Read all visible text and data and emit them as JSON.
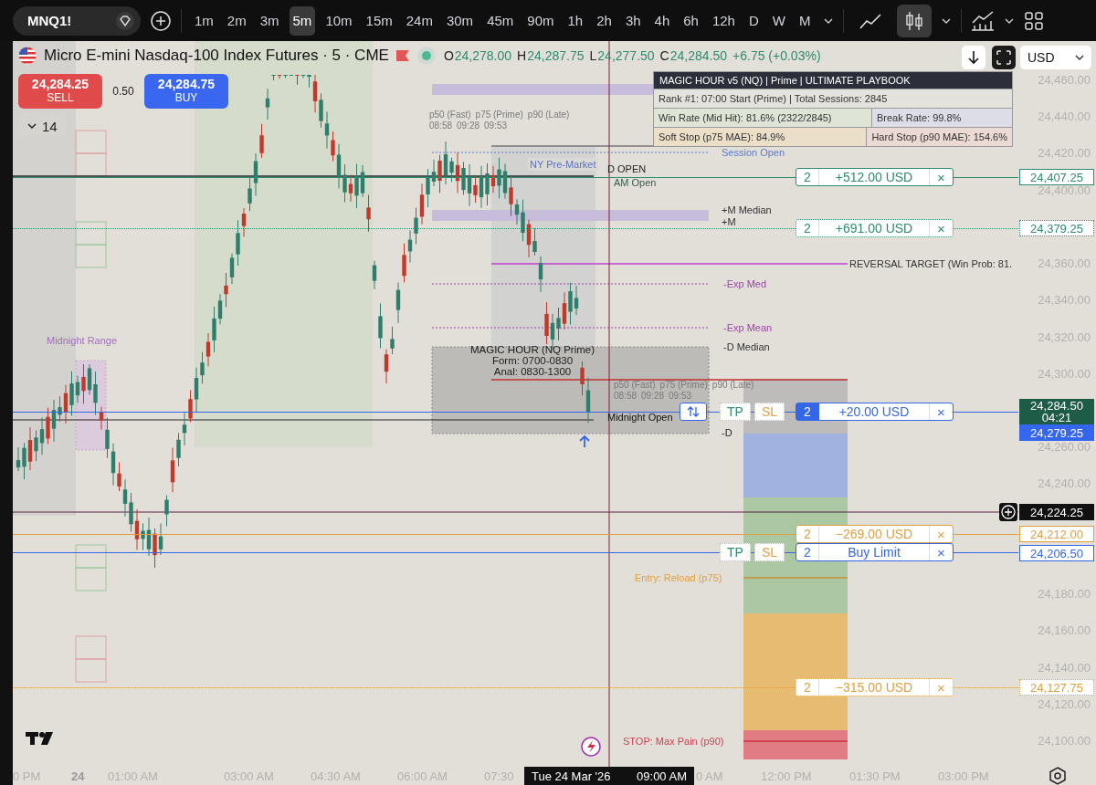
{
  "toolbar": {
    "symbol": "MNQ1!",
    "intervals": [
      {
        "label": "1m",
        "selected": false
      },
      {
        "label": "2m",
        "selected": false
      },
      {
        "label": "3m",
        "selected": false
      },
      {
        "label": "5m",
        "selected": true
      },
      {
        "label": "10m",
        "selected": false
      },
      {
        "label": "15m",
        "selected": false
      },
      {
        "label": "24m",
        "selected": false
      },
      {
        "label": "30m",
        "selected": false
      },
      {
        "label": "45m",
        "selected": false
      },
      {
        "label": "90m",
        "selected": false
      },
      {
        "label": "1h",
        "selected": false
      },
      {
        "label": "2h",
        "selected": false
      },
      {
        "label": "3h",
        "selected": false
      },
      {
        "label": "4h",
        "selected": false
      },
      {
        "label": "6h",
        "selected": false
      },
      {
        "label": "12h",
        "selected": false
      },
      {
        "label": "D",
        "selected": false
      },
      {
        "label": "W",
        "selected": false
      },
      {
        "label": "M",
        "selected": false
      }
    ],
    "chart_types": [
      {
        "kind": "line",
        "selected": false
      },
      {
        "kind": "candles",
        "selected": true
      }
    ]
  },
  "legend": {
    "title": "Micro E-mini Nasdaq-100 Index Futures · 5 · CME",
    "ohlc": [
      {
        "label": "O",
        "value": "24,278.00"
      },
      {
        "label": "H",
        "value": "24,287.75"
      },
      {
        "label": "L",
        "value": "24,277.50"
      },
      {
        "label": "C",
        "value": "24,284.50"
      }
    ],
    "change": "+6.75 (+0.03%)",
    "sell": {
      "price": "24,284.25",
      "label": "SELL"
    },
    "spread": "0.50",
    "buy": {
      "price": "24,284.75",
      "label": "BUY"
    },
    "indicators_count": "14"
  },
  "currency": "USD",
  "stats_panel": {
    "title": "MAGIC HOUR v5 (NQ) | Prime | ULTIMATE PLAYBOOK",
    "rows": [
      {
        "cells": [
          {
            "text": "Rank #1: 07:00 Start (Prime) | Total Sessions: 2845",
            "color": "#e4e2dd"
          }
        ]
      },
      {
        "cells": [
          {
            "text": "Win Rate (Mid Hit): 81.6% (2322/2845)",
            "color": "#dfe5d6"
          },
          {
            "text": "Break Rate: 99.8%",
            "color": "#dcdde6"
          }
        ]
      },
      {
        "cells": [
          {
            "text": "Soft Stop (p75 MAE): 84.9%",
            "color": "#ebdfc8"
          },
          {
            "text": "Hard Stop (p90 MAE): 154.6%",
            "color": "#ebd9d3"
          }
        ]
      }
    ]
  },
  "levels": [
    {
      "label": "Session Open",
      "color": "#5b7bd0"
    },
    {
      "label": "NY Pre-Market",
      "color": "#5b73bd"
    },
    {
      "label": "D OPEN",
      "color": "#222222"
    },
    {
      "label": "AM Open",
      "color": "#3b5e4c"
    },
    {
      "label": "+M Median",
      "color": "#333333"
    },
    {
      "label": "+M",
      "color": "#333333"
    },
    {
      "label": "REVERSAL TARGET (Win Prob: 81.",
      "color": "#333333"
    },
    {
      "label": "-Exp Med",
      "color": "#a040b0"
    },
    {
      "label": "-Exp Mean",
      "color": "#a040b0"
    },
    {
      "label": "-D Median",
      "color": "#333333"
    },
    {
      "label": "Midnight Open",
      "color": "#111111"
    },
    {
      "label": "-D",
      "color": "#222222"
    },
    {
      "label": "Midnight Range",
      "color": "#a070b8"
    },
    {
      "label": "Entry: Reload (p75)",
      "color": "#e0a040"
    },
    {
      "label": "STOP: Max Pain (p90)",
      "color": "#d04050"
    }
  ],
  "session_note": [
    "MAGIC HOUR (NQ Prime)",
    "Form: 0700-0830",
    "Anal: 0830-1300"
  ],
  "percentile_markers": [
    {
      "labels": [
        "p50 (Fast)",
        "p75 (Prime)",
        "p90 (Late)"
      ],
      "times": [
        "08:58",
        "09:28",
        "09:53"
      ]
    },
    {
      "labels": [
        "p50 (Fast)",
        "p75 (Prime)",
        "p90 (Late)"
      ],
      "times": [
        "08:58",
        "09:28",
        "09:53"
      ]
    }
  ],
  "order_lines": [
    {
      "qty": "2",
      "text": "+512.00 USD",
      "close": "×",
      "color": "#2e8b6e",
      "dotted": false,
      "filled_qty": false
    },
    {
      "qty": "2",
      "text": "+691.00 USD",
      "close": "×",
      "color": "#2e8b6e",
      "dotted": true,
      "filled_qty": false
    },
    {
      "qty": "2",
      "text": "+20.00 USD",
      "close": "×",
      "color": "#3466e8",
      "dotted": false,
      "reverse": true,
      "filled_qty": true,
      "brackets": [
        {
          "label": "TP",
          "color": "#2e8b6e"
        },
        {
          "label": "SL",
          "color": "#e0a040"
        }
      ]
    },
    {
      "qty": "2",
      "text": "−269.00 USD",
      "close": "×",
      "color": "#e0a040",
      "dotted": false,
      "filled_qty": false
    },
    {
      "qty": "2",
      "text": "Buy Limit",
      "close": "×",
      "color": "#3466e8",
      "dotted": false,
      "filled_qty": false,
      "brackets": [
        {
          "label": "TP",
          "color": "#2e8b6e"
        },
        {
          "label": "SL",
          "color": "#e0a040"
        }
      ]
    },
    {
      "qty": "2",
      "text": "−315.00 USD",
      "close": "×",
      "color": "#e0a040",
      "dotted": true,
      "filled_qty": false
    }
  ],
  "price_axis": {
    "labels": [
      "24,460.00",
      "24,440.00",
      "24,420.00",
      "24,400.00",
      "24,360.00",
      "24,340.00",
      "24,320.00",
      "24,300.00",
      "24,260.00",
      "24,240.00",
      "24,180.00",
      "24,160.00",
      "24,140.00",
      "24,120.00",
      "24,100.00"
    ],
    "badges": [
      {
        "text": "24,407.25",
        "kind": "order",
        "color": "#2e8b6e"
      },
      {
        "text": "24,379.25",
        "kind": "pending",
        "color": "#2e8b6e"
      },
      {
        "text": "24,284.50",
        "sub": "04:21",
        "kind": "last",
        "color": "#1f5c48"
      },
      {
        "text": "24,279.25",
        "kind": "average",
        "color": "#3466f0"
      },
      {
        "text": "24,224.25",
        "kind": "crosshair",
        "color": "#111111"
      },
      {
        "text": "24,212.00",
        "kind": "order",
        "color": "#e0a040"
      },
      {
        "text": "24,206.50",
        "kind": "order",
        "color": "#3466e8"
      },
      {
        "text": "24,127.75",
        "kind": "pending",
        "color": "#e0a040"
      }
    ]
  },
  "time_axis": {
    "labels": [
      {
        "text": "0 PM",
        "bold": false
      },
      {
        "text": "24",
        "bold": true
      },
      {
        "text": "01:00 AM",
        "bold": false
      },
      {
        "text": "03:00 AM",
        "bold": false
      },
      {
        "text": "04:30 AM",
        "bold": false
      },
      {
        "text": "06:00 AM",
        "bold": false
      },
      {
        "text": "07:30",
        "bold": false
      },
      {
        "text": "0 AM",
        "bold": false
      },
      {
        "text": "12:00 PM",
        "bold": false
      },
      {
        "text": "01:30 PM",
        "bold": false
      },
      {
        "text": "03:00 PM",
        "bold": false
      }
    ],
    "crosshair": {
      "date": "Tue 24 Mar '26",
      "time": "09:00 AM"
    }
  }
}
